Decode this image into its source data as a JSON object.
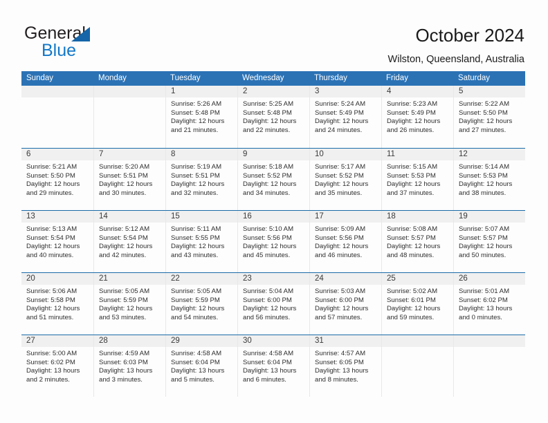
{
  "brand": {
    "word1": "General",
    "word2": "Blue",
    "triangle_icon": "triangle-icon",
    "accent_dark": "#231f20",
    "accent_blue": "#1478c8",
    "triangle_blue": "#1565a8"
  },
  "header": {
    "title": "October 2024",
    "subtitle": "Wilston, Queensland, Australia"
  },
  "colors": {
    "header_blue": "#2b72b5",
    "week_divider_blue": "#1a6aa8",
    "daynum_band": "#f0f0f0",
    "page_background": "#fdfdfd",
    "text": "#2e2e2e"
  },
  "calendar": {
    "weekday_headers": [
      "Sunday",
      "Monday",
      "Tuesday",
      "Wednesday",
      "Thursday",
      "Friday",
      "Saturday"
    ],
    "weeks": [
      [
        {
          "day": "",
          "lines": []
        },
        {
          "day": "",
          "lines": []
        },
        {
          "day": "1",
          "lines": [
            "Sunrise: 5:26 AM",
            "Sunset: 5:48 PM",
            "Daylight: 12 hours",
            "and 21 minutes."
          ]
        },
        {
          "day": "2",
          "lines": [
            "Sunrise: 5:25 AM",
            "Sunset: 5:48 PM",
            "Daylight: 12 hours",
            "and 22 minutes."
          ]
        },
        {
          "day": "3",
          "lines": [
            "Sunrise: 5:24 AM",
            "Sunset: 5:49 PM",
            "Daylight: 12 hours",
            "and 24 minutes."
          ]
        },
        {
          "day": "4",
          "lines": [
            "Sunrise: 5:23 AM",
            "Sunset: 5:49 PM",
            "Daylight: 12 hours",
            "and 26 minutes."
          ]
        },
        {
          "day": "5",
          "lines": [
            "Sunrise: 5:22 AM",
            "Sunset: 5:50 PM",
            "Daylight: 12 hours",
            "and 27 minutes."
          ]
        }
      ],
      [
        {
          "day": "6",
          "lines": [
            "Sunrise: 5:21 AM",
            "Sunset: 5:50 PM",
            "Daylight: 12 hours",
            "and 29 minutes."
          ]
        },
        {
          "day": "7",
          "lines": [
            "Sunrise: 5:20 AM",
            "Sunset: 5:51 PM",
            "Daylight: 12 hours",
            "and 30 minutes."
          ]
        },
        {
          "day": "8",
          "lines": [
            "Sunrise: 5:19 AM",
            "Sunset: 5:51 PM",
            "Daylight: 12 hours",
            "and 32 minutes."
          ]
        },
        {
          "day": "9",
          "lines": [
            "Sunrise: 5:18 AM",
            "Sunset: 5:52 PM",
            "Daylight: 12 hours",
            "and 34 minutes."
          ]
        },
        {
          "day": "10",
          "lines": [
            "Sunrise: 5:17 AM",
            "Sunset: 5:52 PM",
            "Daylight: 12 hours",
            "and 35 minutes."
          ]
        },
        {
          "day": "11",
          "lines": [
            "Sunrise: 5:15 AM",
            "Sunset: 5:53 PM",
            "Daylight: 12 hours",
            "and 37 minutes."
          ]
        },
        {
          "day": "12",
          "lines": [
            "Sunrise: 5:14 AM",
            "Sunset: 5:53 PM",
            "Daylight: 12 hours",
            "and 38 minutes."
          ]
        }
      ],
      [
        {
          "day": "13",
          "lines": [
            "Sunrise: 5:13 AM",
            "Sunset: 5:54 PM",
            "Daylight: 12 hours",
            "and 40 minutes."
          ]
        },
        {
          "day": "14",
          "lines": [
            "Sunrise: 5:12 AM",
            "Sunset: 5:54 PM",
            "Daylight: 12 hours",
            "and 42 minutes."
          ]
        },
        {
          "day": "15",
          "lines": [
            "Sunrise: 5:11 AM",
            "Sunset: 5:55 PM",
            "Daylight: 12 hours",
            "and 43 minutes."
          ]
        },
        {
          "day": "16",
          "lines": [
            "Sunrise: 5:10 AM",
            "Sunset: 5:56 PM",
            "Daylight: 12 hours",
            "and 45 minutes."
          ]
        },
        {
          "day": "17",
          "lines": [
            "Sunrise: 5:09 AM",
            "Sunset: 5:56 PM",
            "Daylight: 12 hours",
            "and 46 minutes."
          ]
        },
        {
          "day": "18",
          "lines": [
            "Sunrise: 5:08 AM",
            "Sunset: 5:57 PM",
            "Daylight: 12 hours",
            "and 48 minutes."
          ]
        },
        {
          "day": "19",
          "lines": [
            "Sunrise: 5:07 AM",
            "Sunset: 5:57 PM",
            "Daylight: 12 hours",
            "and 50 minutes."
          ]
        }
      ],
      [
        {
          "day": "20",
          "lines": [
            "Sunrise: 5:06 AM",
            "Sunset: 5:58 PM",
            "Daylight: 12 hours",
            "and 51 minutes."
          ]
        },
        {
          "day": "21",
          "lines": [
            "Sunrise: 5:05 AM",
            "Sunset: 5:59 PM",
            "Daylight: 12 hours",
            "and 53 minutes."
          ]
        },
        {
          "day": "22",
          "lines": [
            "Sunrise: 5:05 AM",
            "Sunset: 5:59 PM",
            "Daylight: 12 hours",
            "and 54 minutes."
          ]
        },
        {
          "day": "23",
          "lines": [
            "Sunrise: 5:04 AM",
            "Sunset: 6:00 PM",
            "Daylight: 12 hours",
            "and 56 minutes."
          ]
        },
        {
          "day": "24",
          "lines": [
            "Sunrise: 5:03 AM",
            "Sunset: 6:00 PM",
            "Daylight: 12 hours",
            "and 57 minutes."
          ]
        },
        {
          "day": "25",
          "lines": [
            "Sunrise: 5:02 AM",
            "Sunset: 6:01 PM",
            "Daylight: 12 hours",
            "and 59 minutes."
          ]
        },
        {
          "day": "26",
          "lines": [
            "Sunrise: 5:01 AM",
            "Sunset: 6:02 PM",
            "Daylight: 13 hours",
            "and 0 minutes."
          ]
        }
      ],
      [
        {
          "day": "27",
          "lines": [
            "Sunrise: 5:00 AM",
            "Sunset: 6:02 PM",
            "Daylight: 13 hours",
            "and 2 minutes."
          ]
        },
        {
          "day": "28",
          "lines": [
            "Sunrise: 4:59 AM",
            "Sunset: 6:03 PM",
            "Daylight: 13 hours",
            "and 3 minutes."
          ]
        },
        {
          "day": "29",
          "lines": [
            "Sunrise: 4:58 AM",
            "Sunset: 6:04 PM",
            "Daylight: 13 hours",
            "and 5 minutes."
          ]
        },
        {
          "day": "30",
          "lines": [
            "Sunrise: 4:58 AM",
            "Sunset: 6:04 PM",
            "Daylight: 13 hours",
            "and 6 minutes."
          ]
        },
        {
          "day": "31",
          "lines": [
            "Sunrise: 4:57 AM",
            "Sunset: 6:05 PM",
            "Daylight: 13 hours",
            "and 8 minutes."
          ]
        },
        {
          "day": "",
          "lines": []
        },
        {
          "day": "",
          "lines": []
        }
      ]
    ]
  }
}
